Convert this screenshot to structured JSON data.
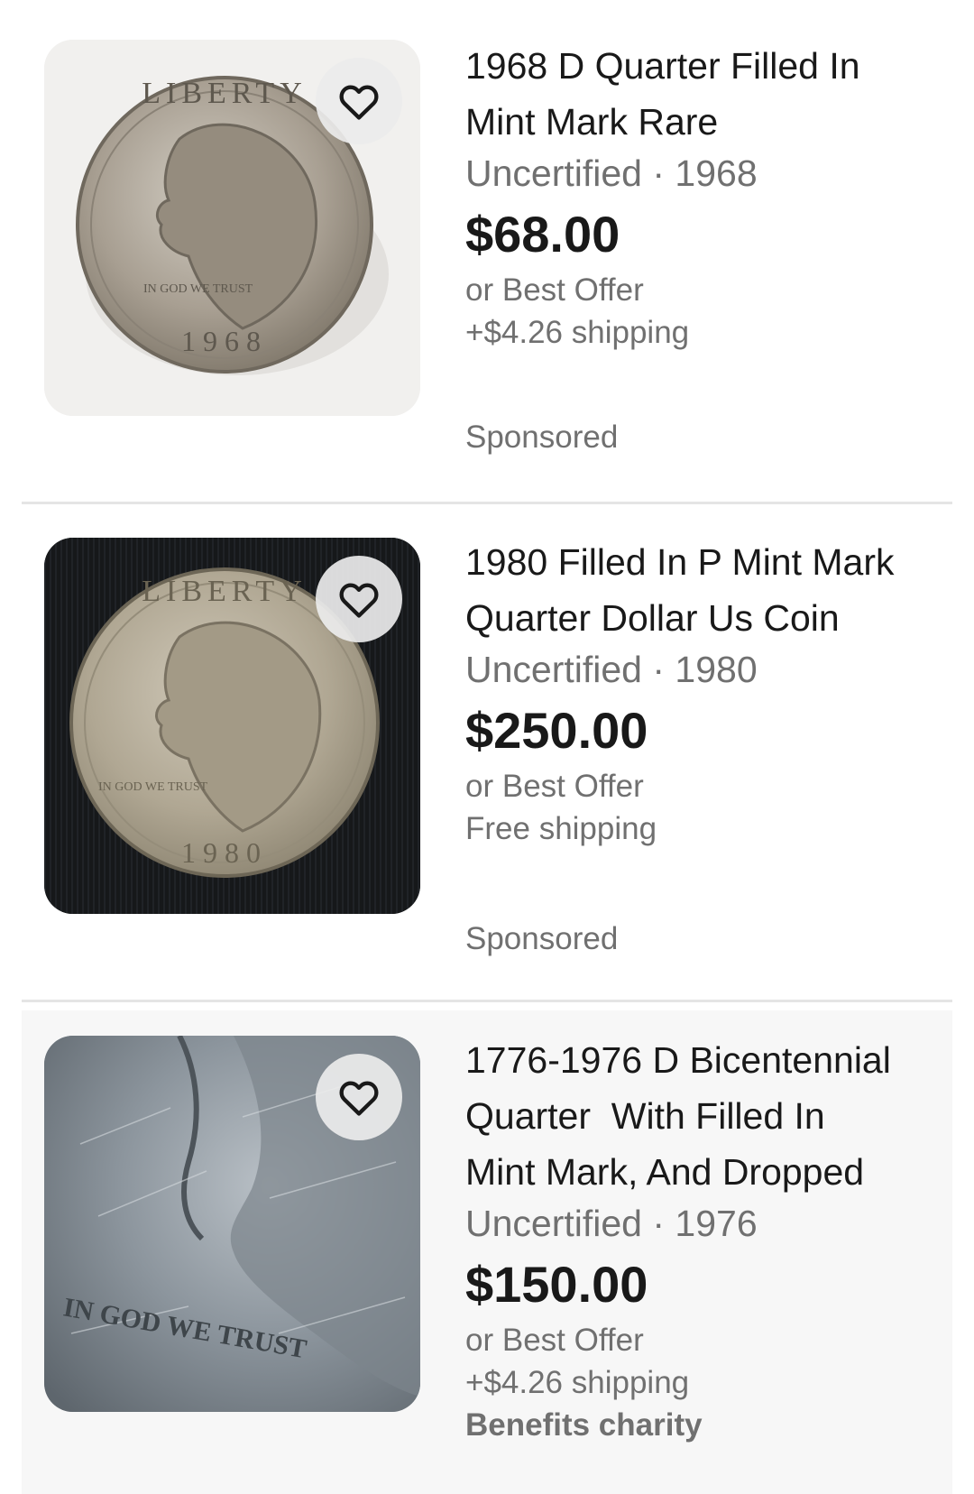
{
  "listings": [
    {
      "title": "1968 D Quarter Filled In\nMint Mark Rare",
      "subtitle": "Uncertified · 1968",
      "price": "$68.00",
      "best_offer": "or Best Offer",
      "shipping": "+$4.26 shipping",
      "badge": "Sponsored",
      "image_alt": "1968 quarter coin photo",
      "coin_year": "1968",
      "coin_liberty": "LIBERTY",
      "coin_motto": "IN GOD WE TRUST"
    },
    {
      "title": "1980 Filled In P Mint Mark\nQuarter Dollar Us Coin",
      "subtitle": "Uncertified · 1980",
      "price": "$250.00",
      "best_offer": "or Best Offer",
      "shipping": "Free shipping",
      "badge": "Sponsored",
      "image_alt": "1980 quarter coin photo",
      "coin_year": "1980",
      "coin_liberty": "LIBERTY",
      "coin_motto": "IN GOD WE TRUST"
    },
    {
      "title": "1776-1976 D Bicentennial\nQuarter  With Filled In\nMint Mark, And Dropped",
      "subtitle": "Uncertified · 1976",
      "price": "$150.00",
      "best_offer": "or Best Offer",
      "shipping": "+$4.26 shipping",
      "extra": "Benefits charity",
      "image_alt": "1976 quarter close-up photo",
      "coin_motto": "IN GOD WE TRUST"
    }
  ],
  "icons": {
    "watch": "heart-icon"
  },
  "colors": {
    "text_primary": "#191919",
    "text_secondary": "#707070",
    "divider": "#e5e5e5",
    "highlight_bg": "#f7f7f7"
  }
}
